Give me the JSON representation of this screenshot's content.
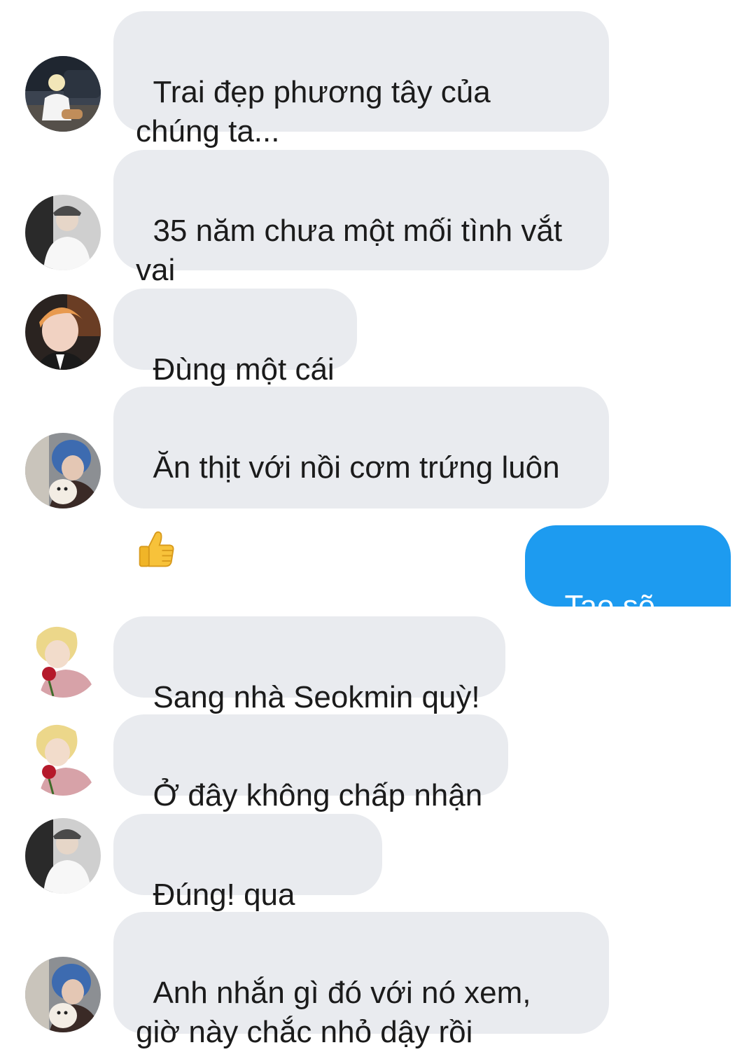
{
  "messages": [
    {
      "text": "Trai đẹp phương tây của\nchúng ta...",
      "direction": "incoming",
      "avatar": "avatar-blond-with-car"
    },
    {
      "text": "35 năm chưa một mối tình vắt\nvai",
      "direction": "incoming",
      "avatar": "avatar-white-shirt"
    },
    {
      "text": "Đùng một cái",
      "direction": "incoming",
      "avatar": "avatar-orange-hair"
    },
    {
      "text": "Ăn thịt với nồi cơm trứng luôn",
      "emoji": "thumbs-up-icon",
      "direction": "incoming",
      "avatar": "avatar-blue-hair-dog"
    },
    {
      "text": "Tao sẽ quỳ",
      "direction": "outgoing"
    },
    {
      "text": "Sang nhà Seokmin quỳ!",
      "direction": "incoming",
      "avatar": "avatar-blond-rose"
    },
    {
      "text": "Ở đây không chấp nhận",
      "direction": "incoming",
      "avatar": "avatar-blond-rose"
    },
    {
      "text": "Đúng! qua luôn",
      "direction": "incoming",
      "avatar": "avatar-white-shirt"
    },
    {
      "text": "Anh nhắn gì đó với nó xem,\ngiờ này chắc nhỏ dậy rồi",
      "direction": "incoming",
      "avatar": "avatar-blue-hair-dog"
    }
  ],
  "colors": {
    "incoming_bubble": "#e9ebef",
    "outgoing_bubble": "#1d9bf0",
    "incoming_text": "#1b1b1b",
    "outgoing_text": "#ffffff"
  }
}
